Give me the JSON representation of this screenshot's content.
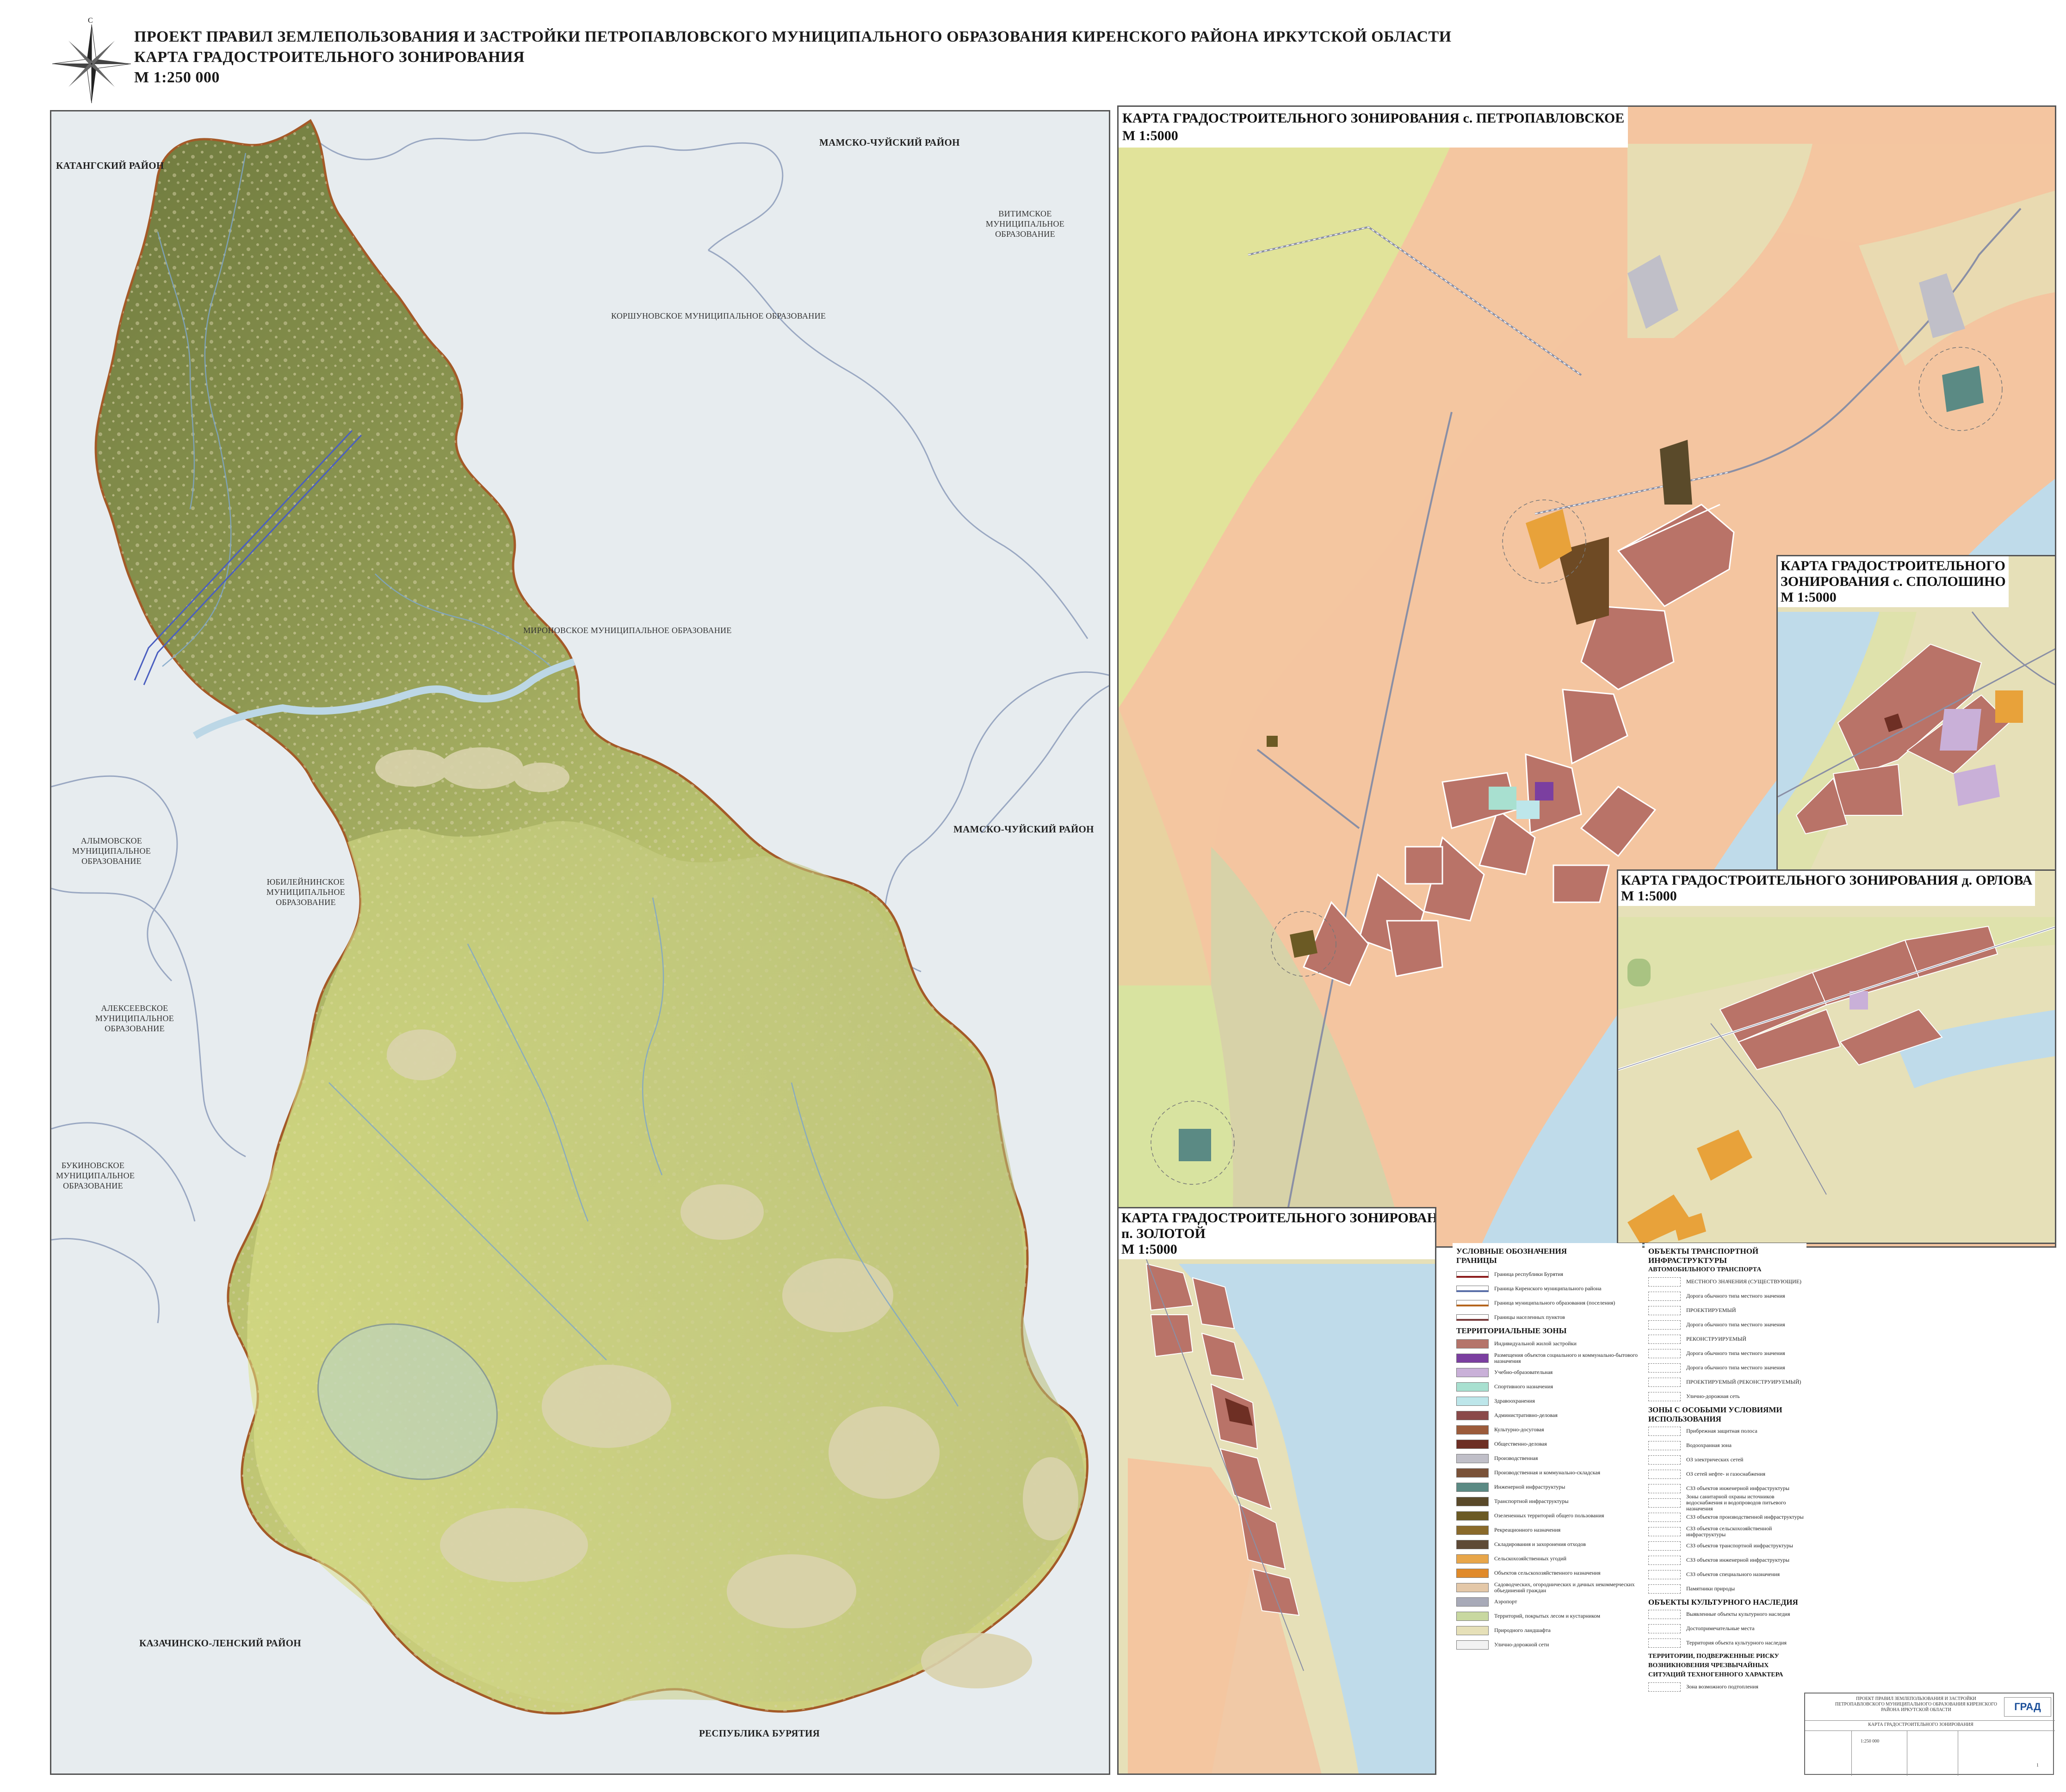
{
  "header": {
    "line1": "ПРОЕКТ ПРАВИЛ ЗЕМЛЕПОЛЬЗОВАНИЯ И ЗАСТРОЙКИ ПЕТРОПАВЛОВСКОГО МУНИЦИПАЛЬНОГО ОБРАЗОВАНИЯ КИРЕНСКОГО РАЙОНА ИРКУТСКОЙ ОБЛАСТИ",
    "line2": "КАРТА ГРАДОСТРОИТЕЛЬНОГО ЗОНИРОВАНИЯ",
    "line3": "М 1:250 000"
  },
  "compass": {
    "north_letter": "С"
  },
  "main_map": {
    "labels": {
      "katanga": "КАТАНГСКИЙ РАЙОН",
      "mamsko_top": "МАМСКО-ЧУЙСКИЙ РАЙОН",
      "vitimskoe": "ВИТИМСКОЕ МУНИЦИПАЛЬНОЕ ОБРАЗОВАНИЕ",
      "korshunovskoe": "КОРШУНОВСКОЕ МУНИЦИПАЛЬНОЕ ОБРАЗОВАНИЕ",
      "mironovskoe": "МИРОНОВСКОЕ МУНИЦИПАЛЬНОЕ ОБРАЗОВАНИЕ",
      "mamsko_right": "МАМСКО-ЧУЙСКИЙ РАЙОН",
      "alymovskoe": "АЛЫМОВСКОЕ МУНИЦИПАЛЬНОЕ ОБРАЗОВАНИЕ",
      "yubileynenskoe": "ЮБИЛЕЙНИНСКОЕ МУНИЦИПАЛЬНОЕ ОБРАЗОВАНИЕ",
      "alekseevskoe": "АЛЕКСЕЕВСКОЕ МУНИЦИПАЛЬНОЕ ОБРАЗОВАНИЕ",
      "bukhovskoe": "БУКИНОВСКОЕ МУНИЦИПАЛЬНОЕ ОБРАЗОВАНИЕ",
      "kazachinsko": "КАЗАЧИНСКО-ЛЕНСКИЙ РАЙОН",
      "buryatia": "РЕСПУБЛИКА БУРЯТИЯ"
    }
  },
  "insets": {
    "petropavlovskoe": {
      "title1": "КАРТА ГРАДОСТРОИТЕЛЬНОГО ЗОНИРОВАНИЯ с. ПЕТРОПАВЛОВСКОЕ",
      "title2": "М 1:5000"
    },
    "spoloshino": {
      "title1": "КАРТА ГРАДОСТРОИТЕЛЬНОГО",
      "title2": "ЗОНИРОВАНИЯ с. СПОЛОШИНО",
      "title3": "М 1:5000"
    },
    "orlova": {
      "title1": "КАРТА ГРАДОСТРОИТЕЛЬНОГО ЗОНИРОВАНИЯ д. ОРЛОВА",
      "title2": "М 1:5000"
    },
    "zolotoy": {
      "title1": "КАРТА ГРАДОСТРОИТЕЛЬНОГО ЗОНИРОВАНИЯ",
      "title2": "п. ЗОЛОТОЙ",
      "title3": "М 1:5000"
    }
  },
  "legend": {
    "title": "УСЛОВНЫЕ ОБОЗНАЧЕНИЯ",
    "boundaries_head": "ГРАНИЦЫ",
    "boundaries": [
      {
        "text": "Граница республики Бурятия",
        "color": "#8b1a1a"
      },
      {
        "text": "Граница Киренского муниципального района",
        "color": "#5a6fa8"
      },
      {
        "text": "Граница муниципального образования (поселения)",
        "color": "#b5651d"
      },
      {
        "text": "Границы населенных пунктов",
        "color": "#7a3b3b"
      }
    ],
    "zones_head": "ТЕРРИТОРИАЛЬНЫЕ ЗОНЫ",
    "zones": [
      {
        "text": "Индивидуальной жилой застройки",
        "color": "#b5746a"
      },
      {
        "text": "Размещения объектов социального и коммунально-бытового назначения",
        "color": "#7b3fa0"
      },
      {
        "text": "Учебно-образовательная",
        "color": "#c9b0d8"
      },
      {
        "text": "Спортивного назначения",
        "color": "#a8e0d0"
      },
      {
        "text": "Здравоохранения",
        "color": "#bde6ea"
      },
      {
        "text": "Административно-деловая",
        "color": "#8a4a4a"
      },
      {
        "text": "Культурно-досуговая",
        "color": "#9c5b3a"
      },
      {
        "text": "Общественно-деловая",
        "color": "#6e2f24"
      },
      {
        "text": "Производственная",
        "color": "#c0bfc8"
      },
      {
        "text": "Производственная и коммунально-складская",
        "color": "#7a5238"
      },
      {
        "text": "Инженерной инфраструктуры",
        "color": "#5b8a84"
      },
      {
        "text": "Транспортной инфраструктуры",
        "color": "#5a4a2a"
      },
      {
        "text": "Озелененных территорий общего пользования",
        "color": "#6b5a24"
      },
      {
        "text": "Рекреационного назначения",
        "color": "#8a6a2a"
      },
      {
        "text": "Складирования и захоронения отходов",
        "color": "#5e4a36"
      },
      {
        "text": "Сельскохозяйственных угодий",
        "color": "#e8a64a"
      },
      {
        "text": "Объектов сельскохозяйственного назначения",
        "color": "#e08a2a"
      },
      {
        "text": "Садоводческих, огороднических и дачных некоммерческих объединений граждан",
        "color": "#e4c8a8"
      },
      {
        "text": "Аэропорт",
        "color": "#a8aab8"
      },
      {
        "text": "Территорий, покрытых лесом и кустарником",
        "color": "#c8d8a0"
      },
      {
        "text": "Природного ландшафта",
        "color": "#e6e0b8"
      },
      {
        "text": "Улично-дорожной сети",
        "color": "#f2f2f2"
      }
    ],
    "transport_head": "ОБЪЕКТЫ ТРАНСПОРТНОЙ ИНФРАСТРУКТУРЫ",
    "transport_sub": "АВТОМОБИЛЬНОГО ТРАНСПОРТА",
    "transport": [
      {
        "text": "МЕСТНОГО ЗНАЧЕНИЯ (СУЩЕСТВУЮЩИЕ)"
      },
      {
        "text": "Дорога обычного типа местного значения"
      },
      {
        "text": "ПРОЕКТИРУЕМЫЙ"
      },
      {
        "text": "Дорога обычного типа местного значения"
      },
      {
        "text": "РЕКОНСТРУИРУЕМЫЙ"
      },
      {
        "text": "Дорога обычного типа местного значения"
      },
      {
        "text": "Дорога обычного типа местного значения"
      },
      {
        "text": "ПРОЕКТИРУЕМЫЙ (РЕКОНСТРУИРУЕМЫЙ)"
      },
      {
        "text": "Улично-дорожная сеть"
      }
    ],
    "special_head": "ЗОНЫ С ОСОБЫМИ УСЛОВИЯМИ ИСПОЛЬЗОВАНИЯ",
    "special": [
      {
        "text": "Прибрежная защитная полоса"
      },
      {
        "text": "Водоохранная зона"
      },
      {
        "text": "ОЗ электрических сетей"
      },
      {
        "text": "ОЗ сетей нефте- и газоснабжения"
      },
      {
        "text": "СЗЗ объектов инженерной инфраструктуры"
      },
      {
        "text": "Зоны санитарной охраны источников водоснабжения и водопроводов питьевого назначения"
      },
      {
        "text": "СЗЗ объектов производственной инфраструктуры"
      },
      {
        "text": "СЗЗ объектов сельскохозяйственной инфраструктуры"
      },
      {
        "text": "СЗЗ объектов транспортной инфраструктуры"
      },
      {
        "text": "СЗЗ объектов инженерной инфраструктуры"
      },
      {
        "text": "СЗЗ объектов специального назначения"
      },
      {
        "text": "Памятники природы"
      }
    ],
    "heritage_head": "ОБЪЕКТЫ КУЛЬТУРНОГО НАСЛЕДИЯ",
    "heritage": [
      {
        "text": "Выявленные объекты культурного наследия"
      },
      {
        "text": "Достопримечательные места"
      },
      {
        "text": "Территория объекта культурного наследия"
      }
    ],
    "risk_head": "ТЕРРИТОРИИ, ПОДВЕРЖЕННЫЕ РИСКУ ВОЗНИКНОВЕНИЯ ЧРЕЗВЫЧАЙНЫХ СИТУАЦИЙ ТЕХНОГЕННОГО ХАРАКТЕРА",
    "risk": [
      {
        "text": "Зона возможного подтопления"
      }
    ]
  },
  "stamp": {
    "org": "ГРАД",
    "project": "ПРОЕКТ ПРАВИЛ ЗЕМЛЕПОЛЬЗОВАНИЯ И ЗАСТРОЙКИ ПЕТРОПАВЛОВСКОГО МУНИЦИПАЛЬНОГО ОБРАЗОВАНИЯ КИРЕНСКОГО РАЙОНА ИРКУТСКОЙ ОБЛАСТИ",
    "sheet": "КАРТА ГРАДОСТРОИТЕЛЬНОГО ЗОНИРОВАНИЯ",
    "scale": "1:250 000",
    "sheet_no": "1"
  },
  "colors": {
    "forest_dark": "#7b8547",
    "forest_light": "#c9cf85",
    "landscape": "#d7d2a8",
    "water": "#bcd7e6",
    "residential": "#b97368",
    "agri": "#f6c7a0",
    "district_border": "#a25b2a",
    "outer_border": "#8aa0c4"
  }
}
